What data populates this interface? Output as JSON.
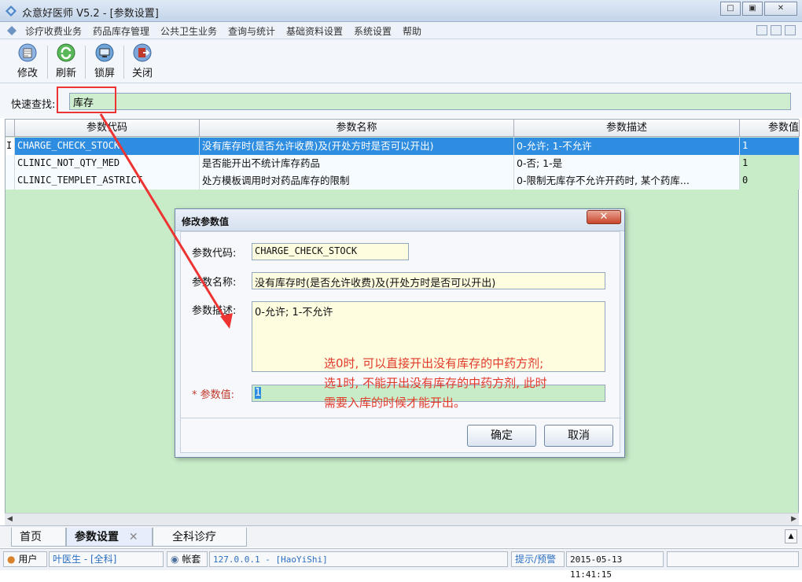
{
  "window": {
    "title": "众意好医师 V5.2 - [参数设置]",
    "buttons": [
      "□",
      "▣",
      "✕"
    ]
  },
  "menubar": {
    "items": [
      "诊疗收费业务",
      "药品库存管理",
      "公共卫生业务",
      "查询与统计",
      "基础资料设置",
      "系统设置",
      "帮助"
    ]
  },
  "toolbar": {
    "edit": "修改",
    "refresh": "刷新",
    "lock": "锁屏",
    "close": "关闭"
  },
  "search": {
    "label": "快速查找:",
    "value": "库存"
  },
  "grid": {
    "columns": [
      "参数代码",
      "参数名称",
      "参数描述",
      "参数值"
    ],
    "rows": [
      {
        "code": "CHARGE_CHECK_STOCK",
        "name": "没有库存时(是否允许收费)及(开处方时是否可以开出)",
        "desc": "0-允许; 1-不允许",
        "value": "1"
      },
      {
        "code": "CLINIC_NOT_QTY_MED",
        "name": "是否能开出不统计库存药品",
        "desc": "0-否; 1-是",
        "value": "1"
      },
      {
        "code": "CLINIC_TEMPLET_ASTRICT",
        "name": "处方模板调用时对药品库存的限制",
        "desc": "0-限制无库存不允许开药时, 某个药库...",
        "value": "0"
      }
    ],
    "row_marker": "I"
  },
  "dialog": {
    "title": "修改参数值",
    "code_label": "参数代码:",
    "code_value": "CHARGE_CHECK_STOCK",
    "name_label": "参数名称:",
    "name_value": "没有库存时(是否允许收费)及(开处方时是否可以开出)",
    "desc_label": "参数描述:",
    "desc_value": "0-允许; 1-不允许",
    "value_label": "* 参数值:",
    "value_value": "1",
    "ok": "确定",
    "cancel": "取消"
  },
  "annotation": {
    "line1": "选0时, 可以直接开出没有库存的中药方剂;",
    "line2": "选1时, 不能开出没有库存的中药方剂, 此时",
    "line3": "需要入库的时候才能开出。",
    "color": "#e23a2a"
  },
  "tabs": {
    "home": "首页",
    "params": "参数设置",
    "params_close": "✕",
    "clinic": "全科诊疗"
  },
  "statusbar": {
    "user_label": "用户",
    "user_value": "叶医生 - [全科]",
    "account_label": "帐套",
    "account_value": "127.0.0.1 - [HaoYiShi]",
    "alert": "提示/预警",
    "datetime": "2015-05-13 11:41:15"
  },
  "colors": {
    "grid_bg": "#c8ecc8",
    "selected": "#2e8de0",
    "accent_red": "#e33333"
  }
}
